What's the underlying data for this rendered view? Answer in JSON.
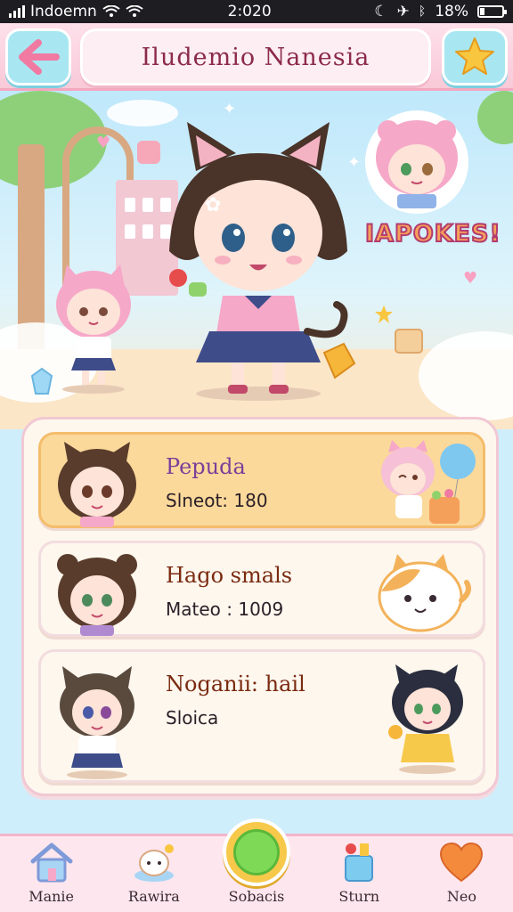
{
  "status_bar": {
    "carrier": "Indoemn",
    "time": "2:020",
    "battery": "18%"
  },
  "header": {
    "title": "Iludemio Nanesia",
    "back_icon": "back-arrow-icon",
    "star_icon": "star-icon"
  },
  "scene": {
    "badge": "IAPOKES!"
  },
  "list": {
    "items": [
      {
        "name": "Pepuda",
        "sub": "Slneot: 180",
        "active": true,
        "name_color": "#7a3f9a"
      },
      {
        "name": "Hago smals",
        "sub": "Mateo : 1009",
        "active": false,
        "name_color": "#7a2a10"
      },
      {
        "name": "Noganii: hail",
        "sub": "Sloica",
        "active": false,
        "name_color": "#7a2a10"
      }
    ]
  },
  "nav": {
    "items": [
      {
        "label": "Manie",
        "icon": "home-icon"
      },
      {
        "label": "Rawira",
        "icon": "pet-icon"
      },
      {
        "label": "Sobacis",
        "icon": "play-orb-icon"
      },
      {
        "label": "Sturn",
        "icon": "shop-cup-icon"
      },
      {
        "label": "Neo",
        "icon": "heart-icon"
      }
    ]
  },
  "colors": {
    "accent_pink": "#f07aa2",
    "header_bg": "#f9c9d8",
    "active_card": "#fbd99b",
    "nav_bg": "#fde6ee"
  }
}
